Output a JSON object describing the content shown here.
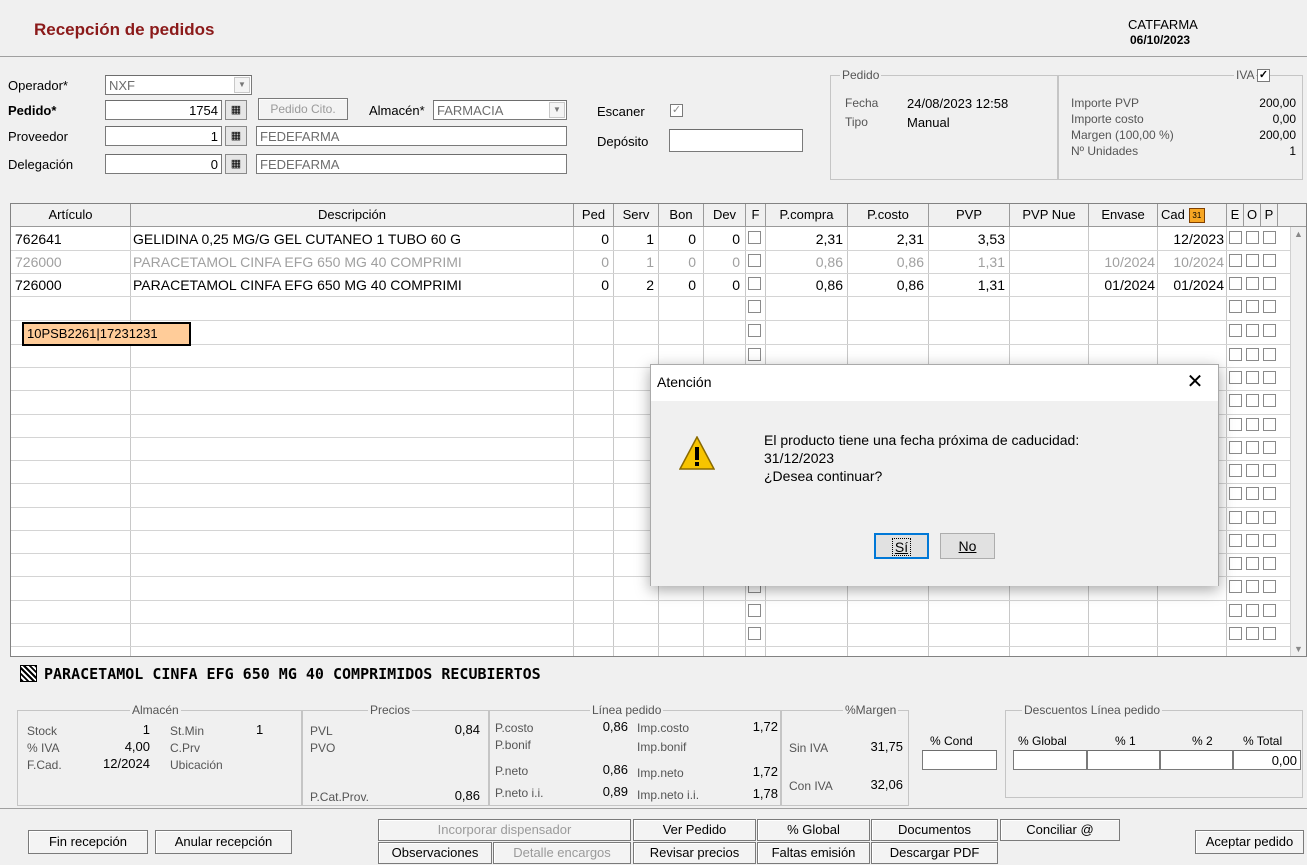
{
  "header": {
    "title": "Recepción de pedidos",
    "company": "CATFARMA",
    "date": "06/10/2023"
  },
  "form": {
    "operador_label": "Operador*",
    "operador_value": "NXF",
    "pedido_label": "Pedido*",
    "pedido_value": "1754",
    "pedido_cito_button": "Pedido Cito.",
    "almacen_label": "Almacén*",
    "almacen_value": "FARMACIA",
    "escaner_label": "Escaner",
    "deposito_label": "Depósito",
    "deposito_value": "",
    "proveedor_label": "Proveedor",
    "proveedor_code": "1",
    "proveedor_name": "FEDEFARMA",
    "delegacion_label": "Delegación",
    "delegacion_code": "0",
    "delegacion_name": "FEDEFARMA"
  },
  "pedido_group": {
    "title": "Pedido",
    "fecha_label": "Fecha",
    "fecha_value": "24/08/2023 12:58",
    "tipo_label": "Tipo",
    "tipo_value": "Manual"
  },
  "iva_group": {
    "title": "IVA",
    "importe_pvp_label": "Importe PVP",
    "importe_pvp": "200,00",
    "importe_costo_label": "Importe costo",
    "importe_costo": "0,00",
    "margen_label": "Margen (100,00 %)",
    "margen": "200,00",
    "unidades_label": "Nº Unidades",
    "unidades": "1"
  },
  "grid": {
    "headers": [
      "Artículo",
      "Descripción",
      "Ped",
      "Serv",
      "Bon",
      "Dev",
      "F",
      "P.compra",
      "P.costo",
      "PVP",
      "PVP Nue",
      "Envase",
      "Cad",
      "E",
      "O",
      "P"
    ],
    "rows": [
      {
        "articulo": "762641",
        "descripcion": "GELIDINA 0,25 MG/G GEL CUTANEO 1 TUBO 60 G",
        "ped": "0",
        "serv": "1",
        "bon": "0",
        "dev": "0",
        "pcompra": "2,31",
        "pcosto": "2,31",
        "pvp": "3,53",
        "pvpnue": "",
        "envase": "",
        "cad": "12/2023"
      },
      {
        "articulo": "726000",
        "descripcion": "PARACETAMOL CINFA EFG 650 MG 40 COMPRIMI",
        "ped": "0",
        "serv": "1",
        "bon": "0",
        "dev": "0",
        "pcompra": "0,86",
        "pcosto": "0,86",
        "pvp": "1,31",
        "pvpnue": "",
        "envase": "10/2024",
        "cad": "10/2024"
      },
      {
        "articulo": "726000",
        "descripcion": "PARACETAMOL CINFA EFG 650 MG 40 COMPRIMI",
        "ped": "0",
        "serv": "2",
        "bon": "0",
        "dev": "0",
        "pcompra": "0,86",
        "pcosto": "0,86",
        "pvp": "1,31",
        "pvpnue": "",
        "envase": "01/2024",
        "cad": "01/2024"
      }
    ],
    "edit_value": "10PSB2261|17231231"
  },
  "product_title": "PARACETAMOL CINFA EFG 650 MG 40 COMPRIMIDOS RECUBIERTOS",
  "almacen_panel": {
    "title": "Almacén",
    "stock_label": "Stock",
    "stock": "1",
    "stmin_label": "St.Min",
    "stmin": "1",
    "iva_label": "% IVA",
    "iva": "4,00",
    "cprv_label": "C.Prv",
    "fcad_label": "F.Cad.",
    "fcad": "12/2024",
    "ubicacion_label": "Ubicación"
  },
  "precios_panel": {
    "title": "Precios",
    "pvl_label": "PVL",
    "pvl": "0,84",
    "pvo_label": "PVO",
    "pcatprov_label": "P.Cat.Prov.",
    "pcatprov": "0,86"
  },
  "linea_panel": {
    "title": "Línea pedido",
    "pcosto_label": "P.costo",
    "pcosto": "0,86",
    "impcosto_label": "Imp.costo",
    "impcosto": "1,72",
    "pbonif_label": "P.bonif",
    "impbonif_label": "Imp.bonif",
    "pneto_label": "P.neto",
    "pneto": "0,86",
    "impneto_label": "Imp.neto",
    "impneto": "1,72",
    "pnetoii_label": "P.neto i.i.",
    "pnetoii": "0,89",
    "impnetoii_label": "Imp.neto i.i.",
    "impnetoii": "1,78"
  },
  "margen_panel": {
    "title": "%Margen",
    "siniva_label": "Sin IVA",
    "siniva": "31,75",
    "coniva_label": "Con IVA",
    "coniva": "32,06",
    "cond_label": "% Cond"
  },
  "descuentos_panel": {
    "title": "Descuentos Línea pedido",
    "global_label": "% Global",
    "d1_label": "% 1",
    "d2_label": "% 2",
    "total_label": "% Total",
    "total": "0,00"
  },
  "footer": {
    "fin_recepcion": "Fin recepción",
    "anular_recepcion": "Anular recepción",
    "incorporar_dispensador": "Incorporar dispensador",
    "observaciones": "Observaciones",
    "detalle_encargos": "Detalle encargos",
    "ver_pedido": "Ver Pedido",
    "revisar_precios": "Revisar precios",
    "global": "% Global",
    "faltas_emision": "Faltas emisión",
    "documentos": "Documentos",
    "descargar_pdf": "Descargar PDF",
    "conciliar": "Conciliar @",
    "aceptar_pedido": "Aceptar pedido"
  },
  "dialog": {
    "title": "Atención",
    "line1": "El producto tiene una fecha próxima de caducidad:",
    "line2": "31/12/2023",
    "line3": "¿Desea continuar?",
    "yes": "Sí",
    "no": "No"
  }
}
